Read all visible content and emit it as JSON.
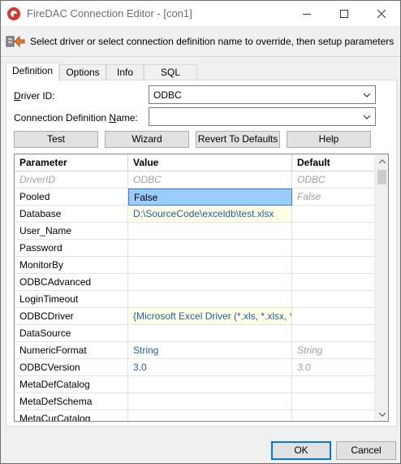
{
  "window": {
    "title": "FireDAC Connection Editor - [con1]"
  },
  "header": {
    "instruction": "Select driver or select connection definition name to override, then setup parameters"
  },
  "tabs": [
    {
      "label": "Definition",
      "active": true
    },
    {
      "label": "Options",
      "active": false
    },
    {
      "label": "Info",
      "active": false
    },
    {
      "label": "SQL Script",
      "active": false
    }
  ],
  "form": {
    "driver_id_label": "Driver ID:",
    "driver_id_value": "ODBC",
    "conn_def_label": "Connection Definition Name:",
    "conn_def_value": ""
  },
  "actions": {
    "test": "Test",
    "wizard": "Wizard",
    "revert": "Revert To Defaults",
    "help": "Help"
  },
  "grid": {
    "columns": [
      "Parameter",
      "Value",
      "Default"
    ],
    "rows": [
      {
        "param": "DriverID",
        "value": "ODBC",
        "default": "ODBC"
      },
      {
        "param": "Pooled",
        "value": "False",
        "default": "False"
      },
      {
        "param": "Database",
        "value": "D:\\SourceCode\\exceldb\\test.xlsx",
        "default": ""
      },
      {
        "param": "User_Name",
        "value": "",
        "default": ""
      },
      {
        "param": "Password",
        "value": "",
        "default": ""
      },
      {
        "param": "MonitorBy",
        "value": "",
        "default": ""
      },
      {
        "param": "ODBCAdvanced",
        "value": "",
        "default": ""
      },
      {
        "param": "LoginTimeout",
        "value": "",
        "default": ""
      },
      {
        "param": "ODBCDriver",
        "value": "{Microsoft Excel Driver (*.xls, *.xlsx, *",
        "default": ""
      },
      {
        "param": "DataSource",
        "value": "",
        "default": ""
      },
      {
        "param": "NumericFormat",
        "value": "String",
        "default": "String"
      },
      {
        "param": "ODBCVersion",
        "value": "3.0",
        "default": "3.0"
      },
      {
        "param": "MetaDefCatalog",
        "value": "",
        "default": ""
      },
      {
        "param": "MetaDefSchema",
        "value": "",
        "default": ""
      },
      {
        "param": "MetaCurCatalog",
        "value": "",
        "default": ""
      }
    ]
  },
  "footer": {
    "ok": "OK",
    "cancel": "Cancel"
  },
  "icons": {
    "app": "firedac-icon",
    "header": "connection-wizard-icon",
    "minimize": "minimize-icon",
    "maximize": "maximize-icon",
    "close": "close-icon",
    "dropdown": "chevron-down-icon"
  },
  "colors": {
    "selection": "#99ccff",
    "value_text": "#1f5ea8",
    "default_text": "#a0a0a0",
    "modified_bg": "#ffffe6"
  }
}
